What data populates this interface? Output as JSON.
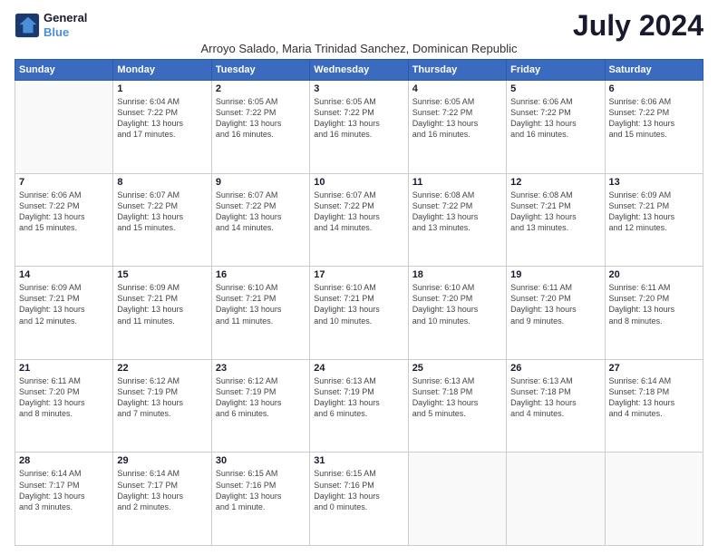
{
  "logo": {
    "line1": "General",
    "line2": "Blue"
  },
  "title": "July 2024",
  "subtitle": "Arroyo Salado, Maria Trinidad Sanchez, Dominican Republic",
  "headers": [
    "Sunday",
    "Monday",
    "Tuesday",
    "Wednesday",
    "Thursday",
    "Friday",
    "Saturday"
  ],
  "weeks": [
    [
      {
        "day": "",
        "info": ""
      },
      {
        "day": "1",
        "info": "Sunrise: 6:04 AM\nSunset: 7:22 PM\nDaylight: 13 hours\nand 17 minutes."
      },
      {
        "day": "2",
        "info": "Sunrise: 6:05 AM\nSunset: 7:22 PM\nDaylight: 13 hours\nand 16 minutes."
      },
      {
        "day": "3",
        "info": "Sunrise: 6:05 AM\nSunset: 7:22 PM\nDaylight: 13 hours\nand 16 minutes."
      },
      {
        "day": "4",
        "info": "Sunrise: 6:05 AM\nSunset: 7:22 PM\nDaylight: 13 hours\nand 16 minutes."
      },
      {
        "day": "5",
        "info": "Sunrise: 6:06 AM\nSunset: 7:22 PM\nDaylight: 13 hours\nand 16 minutes."
      },
      {
        "day": "6",
        "info": "Sunrise: 6:06 AM\nSunset: 7:22 PM\nDaylight: 13 hours\nand 15 minutes."
      }
    ],
    [
      {
        "day": "7",
        "info": "Sunrise: 6:06 AM\nSunset: 7:22 PM\nDaylight: 13 hours\nand 15 minutes."
      },
      {
        "day": "8",
        "info": "Sunrise: 6:07 AM\nSunset: 7:22 PM\nDaylight: 13 hours\nand 15 minutes."
      },
      {
        "day": "9",
        "info": "Sunrise: 6:07 AM\nSunset: 7:22 PM\nDaylight: 13 hours\nand 14 minutes."
      },
      {
        "day": "10",
        "info": "Sunrise: 6:07 AM\nSunset: 7:22 PM\nDaylight: 13 hours\nand 14 minutes."
      },
      {
        "day": "11",
        "info": "Sunrise: 6:08 AM\nSunset: 7:22 PM\nDaylight: 13 hours\nand 13 minutes."
      },
      {
        "day": "12",
        "info": "Sunrise: 6:08 AM\nSunset: 7:21 PM\nDaylight: 13 hours\nand 13 minutes."
      },
      {
        "day": "13",
        "info": "Sunrise: 6:09 AM\nSunset: 7:21 PM\nDaylight: 13 hours\nand 12 minutes."
      }
    ],
    [
      {
        "day": "14",
        "info": "Sunrise: 6:09 AM\nSunset: 7:21 PM\nDaylight: 13 hours\nand 12 minutes."
      },
      {
        "day": "15",
        "info": "Sunrise: 6:09 AM\nSunset: 7:21 PM\nDaylight: 13 hours\nand 11 minutes."
      },
      {
        "day": "16",
        "info": "Sunrise: 6:10 AM\nSunset: 7:21 PM\nDaylight: 13 hours\nand 11 minutes."
      },
      {
        "day": "17",
        "info": "Sunrise: 6:10 AM\nSunset: 7:21 PM\nDaylight: 13 hours\nand 10 minutes."
      },
      {
        "day": "18",
        "info": "Sunrise: 6:10 AM\nSunset: 7:20 PM\nDaylight: 13 hours\nand 10 minutes."
      },
      {
        "day": "19",
        "info": "Sunrise: 6:11 AM\nSunset: 7:20 PM\nDaylight: 13 hours\nand 9 minutes."
      },
      {
        "day": "20",
        "info": "Sunrise: 6:11 AM\nSunset: 7:20 PM\nDaylight: 13 hours\nand 8 minutes."
      }
    ],
    [
      {
        "day": "21",
        "info": "Sunrise: 6:11 AM\nSunset: 7:20 PM\nDaylight: 13 hours\nand 8 minutes."
      },
      {
        "day": "22",
        "info": "Sunrise: 6:12 AM\nSunset: 7:19 PM\nDaylight: 13 hours\nand 7 minutes."
      },
      {
        "day": "23",
        "info": "Sunrise: 6:12 AM\nSunset: 7:19 PM\nDaylight: 13 hours\nand 6 minutes."
      },
      {
        "day": "24",
        "info": "Sunrise: 6:13 AM\nSunset: 7:19 PM\nDaylight: 13 hours\nand 6 minutes."
      },
      {
        "day": "25",
        "info": "Sunrise: 6:13 AM\nSunset: 7:18 PM\nDaylight: 13 hours\nand 5 minutes."
      },
      {
        "day": "26",
        "info": "Sunrise: 6:13 AM\nSunset: 7:18 PM\nDaylight: 13 hours\nand 4 minutes."
      },
      {
        "day": "27",
        "info": "Sunrise: 6:14 AM\nSunset: 7:18 PM\nDaylight: 13 hours\nand 4 minutes."
      }
    ],
    [
      {
        "day": "28",
        "info": "Sunrise: 6:14 AM\nSunset: 7:17 PM\nDaylight: 13 hours\nand 3 minutes."
      },
      {
        "day": "29",
        "info": "Sunrise: 6:14 AM\nSunset: 7:17 PM\nDaylight: 13 hours\nand 2 minutes."
      },
      {
        "day": "30",
        "info": "Sunrise: 6:15 AM\nSunset: 7:16 PM\nDaylight: 13 hours\nand 1 minute."
      },
      {
        "day": "31",
        "info": "Sunrise: 6:15 AM\nSunset: 7:16 PM\nDaylight: 13 hours\nand 0 minutes."
      },
      {
        "day": "",
        "info": ""
      },
      {
        "day": "",
        "info": ""
      },
      {
        "day": "",
        "info": ""
      }
    ]
  ]
}
